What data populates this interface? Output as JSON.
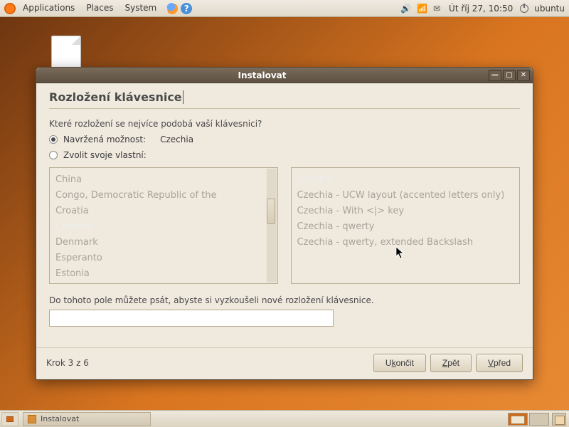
{
  "panel": {
    "menus": [
      "Applications",
      "Places",
      "System"
    ],
    "clock": "Út říj 27, 10:50",
    "user": "ubuntu"
  },
  "window": {
    "title": "Instalovat",
    "heading": "Rozložení klávesnice",
    "question": "Které rozložení se nejvíce podobá vaší klávesnici?",
    "opt_suggested_label": "Navržená možnost:",
    "opt_suggested_value": "Czechia",
    "opt_own_label": "Zvolit svoje vlastní:",
    "left_list": [
      "China",
      "Congo, Democratic Republic of the",
      "Croatia",
      "Czechia",
      "Denmark",
      "Esperanto",
      "Estonia"
    ],
    "left_selected": "Czechia",
    "right_list": [
      "Czechia",
      "Czechia - UCW layout (accented letters only)",
      "Czechia - With <|> key",
      "Czechia - qwerty",
      "Czechia - qwerty, extended Backslash"
    ],
    "right_selected": "Czechia",
    "test_label": "Do tohoto pole můžete psát, abyste si vyzkoušeli nové rozložení klávesnice.",
    "step": "Krok 3 z 6",
    "btn_quit": "Ukončit",
    "btn_back": "Zpět",
    "btn_forward": "Vpřed"
  },
  "taskbar": {
    "task_title": "Instalovat"
  }
}
